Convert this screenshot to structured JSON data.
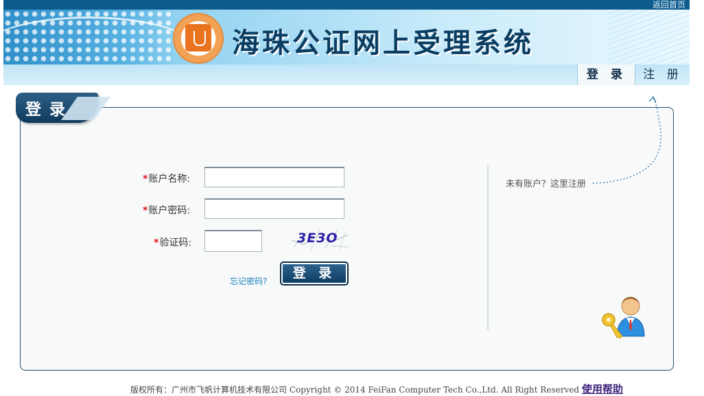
{
  "header": {
    "home_link": "返回首页",
    "site_title": "海珠公证网上受理系统"
  },
  "nav": {
    "login": "登 录",
    "register": "注 册"
  },
  "panel": {
    "tab_label": "登 录"
  },
  "form": {
    "required_mark": "*",
    "account_label": "账户名称:",
    "password_label": "账户密码:",
    "captcha_label": "验证码:",
    "account_value": "",
    "password_value": "",
    "captcha_value": "",
    "captcha_image_text": "3E3O",
    "forgot_link": "忘记密码?",
    "login_button": "登 录"
  },
  "sidebar": {
    "register_hint": "未有账户？这里注册"
  },
  "footer": {
    "copyright": "版权所有：广州市飞帆计算机技术有限公司 Copyright © 2014 FeiFan Computer Tech Co.,Ltd. All Right Reserved",
    "help_link": "使用帮助"
  },
  "colors": {
    "brand_dark": "#0d5a8c",
    "required_red": "#e0141b",
    "link_blue": "#1a7fb8"
  }
}
